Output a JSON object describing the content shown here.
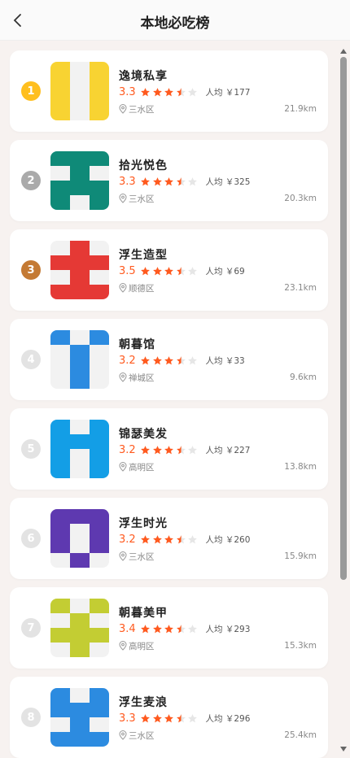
{
  "header": {
    "title": "本地必吃榜",
    "back_icon": "chevron-left-icon"
  },
  "colors": {
    "accent": "#ff5a1f",
    "rank_gold": "#ffbf1f",
    "rank_silver": "#aaaaaa",
    "rank_bronze": "#c47a34",
    "rank_other": "#e3e3e3"
  },
  "list": [
    {
      "rank": "1",
      "name": "逸境私享",
      "score": "3.3",
      "stars": 3.5,
      "price": "人均 ￥177",
      "district": "三水区",
      "distance": "21.9km",
      "thumb_color": "#f8d332"
    },
    {
      "rank": "2",
      "name": "拾光悦色",
      "score": "3.3",
      "stars": 3.5,
      "price": "人均 ￥325",
      "district": "三水区",
      "distance": "20.3km",
      "thumb_color": "#0f8a78"
    },
    {
      "rank": "3",
      "name": "浮生造型",
      "score": "3.5",
      "stars": 3.5,
      "price": "人均 ￥69",
      "district": "顺德区",
      "distance": "23.1km",
      "thumb_color": "#e53935"
    },
    {
      "rank": "4",
      "name": "朝暮馆",
      "score": "3.2",
      "stars": 3.5,
      "price": "人均 ￥33",
      "district": "禅城区",
      "distance": "9.6km",
      "thumb_color": "#2c8be0"
    },
    {
      "rank": "5",
      "name": "锦瑟美发",
      "score": "3.2",
      "stars": 3.5,
      "price": "人均 ￥227",
      "district": "高明区",
      "distance": "13.8km",
      "thumb_color": "#139ee6"
    },
    {
      "rank": "6",
      "name": "浮生时光",
      "score": "3.2",
      "stars": 3.5,
      "price": "人均 ￥260",
      "district": "三水区",
      "distance": "15.9km",
      "thumb_color": "#5e39b0"
    },
    {
      "rank": "7",
      "name": "朝暮美甲",
      "score": "3.4",
      "stars": 3.5,
      "price": "人均 ￥293",
      "district": "高明区",
      "distance": "15.3km",
      "thumb_color": "#c3cd33"
    },
    {
      "rank": "8",
      "name": "浮生麦浪",
      "score": "3.3",
      "stars": 3.5,
      "price": "人均 ￥296",
      "district": "三水区",
      "distance": "25.4km",
      "thumb_color": "#2c8be0"
    }
  ]
}
